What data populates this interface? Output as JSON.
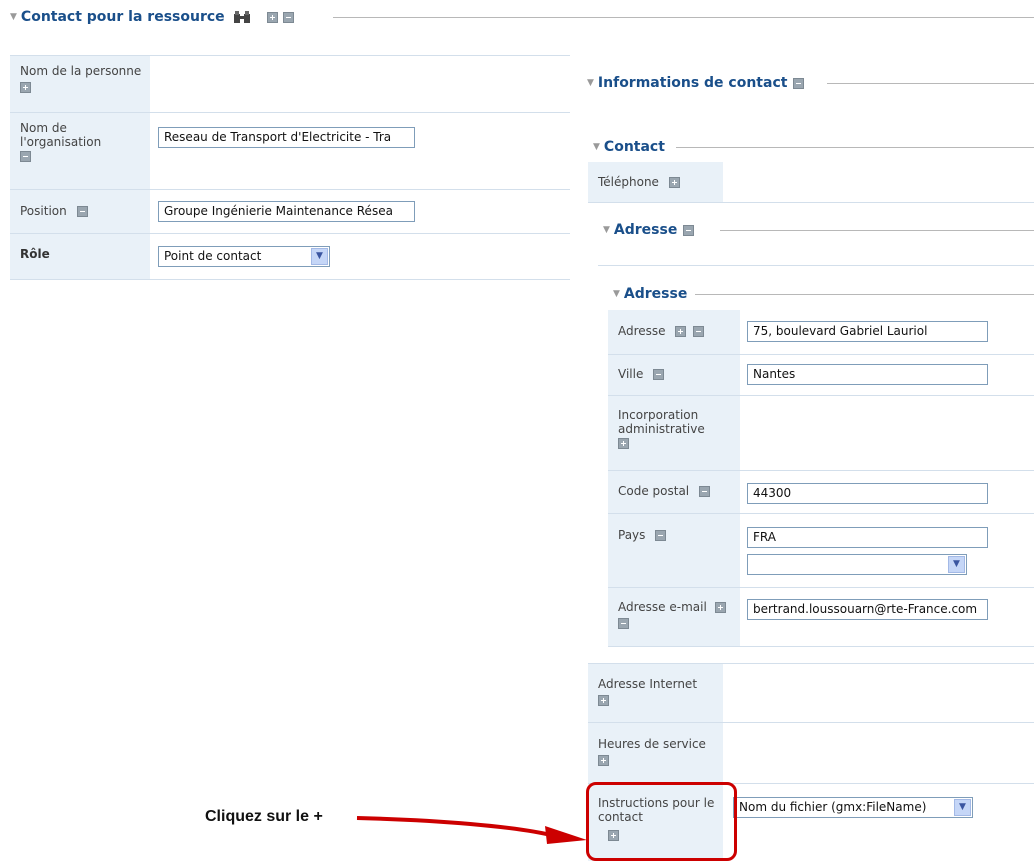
{
  "left": {
    "section_title": "Contact pour la ressource",
    "rows": [
      {
        "label": "Nom de la personne"
      },
      {
        "label": "Nom de l'organisation",
        "value": "Reseau de Transport d'Electricite - Tra"
      },
      {
        "label": "Position",
        "value": "Groupe Ingénierie Maintenance Résea"
      },
      {
        "label": "Rôle",
        "value": "Point de contact"
      }
    ]
  },
  "right": {
    "section_title": "Informations de contact",
    "contact_title": "Contact",
    "telephone_label": "Téléphone",
    "address_group_title": "Adresse",
    "address_title": "Adresse",
    "address_rows": [
      {
        "label": "Adresse",
        "value": "75, boulevard Gabriel Lauriol"
      },
      {
        "label": "Ville",
        "value": "Nantes"
      },
      {
        "label": "Incorporation administrative"
      },
      {
        "label": "Code postal",
        "value": "44300"
      },
      {
        "label": "Pays",
        "value": "FRA",
        "select_value": ""
      },
      {
        "label": "Adresse e-mail",
        "value": "bertrand.loussouarn@rte-France.com"
      }
    ],
    "internet_label": "Adresse Internet",
    "hours_label": "Heures de service",
    "instructions_label": "Instructions pour le contact",
    "instructions_value": "Nom du fichier (gmx:FileName)"
  },
  "annotation": {
    "text": "Cliquez sur le +",
    "color": "#cc0000"
  },
  "icons": [
    "binoculars-icon",
    "plus-icon",
    "minus-icon",
    "triangle-down-icon",
    "chevron-down-icon",
    "arrow-icon"
  ]
}
